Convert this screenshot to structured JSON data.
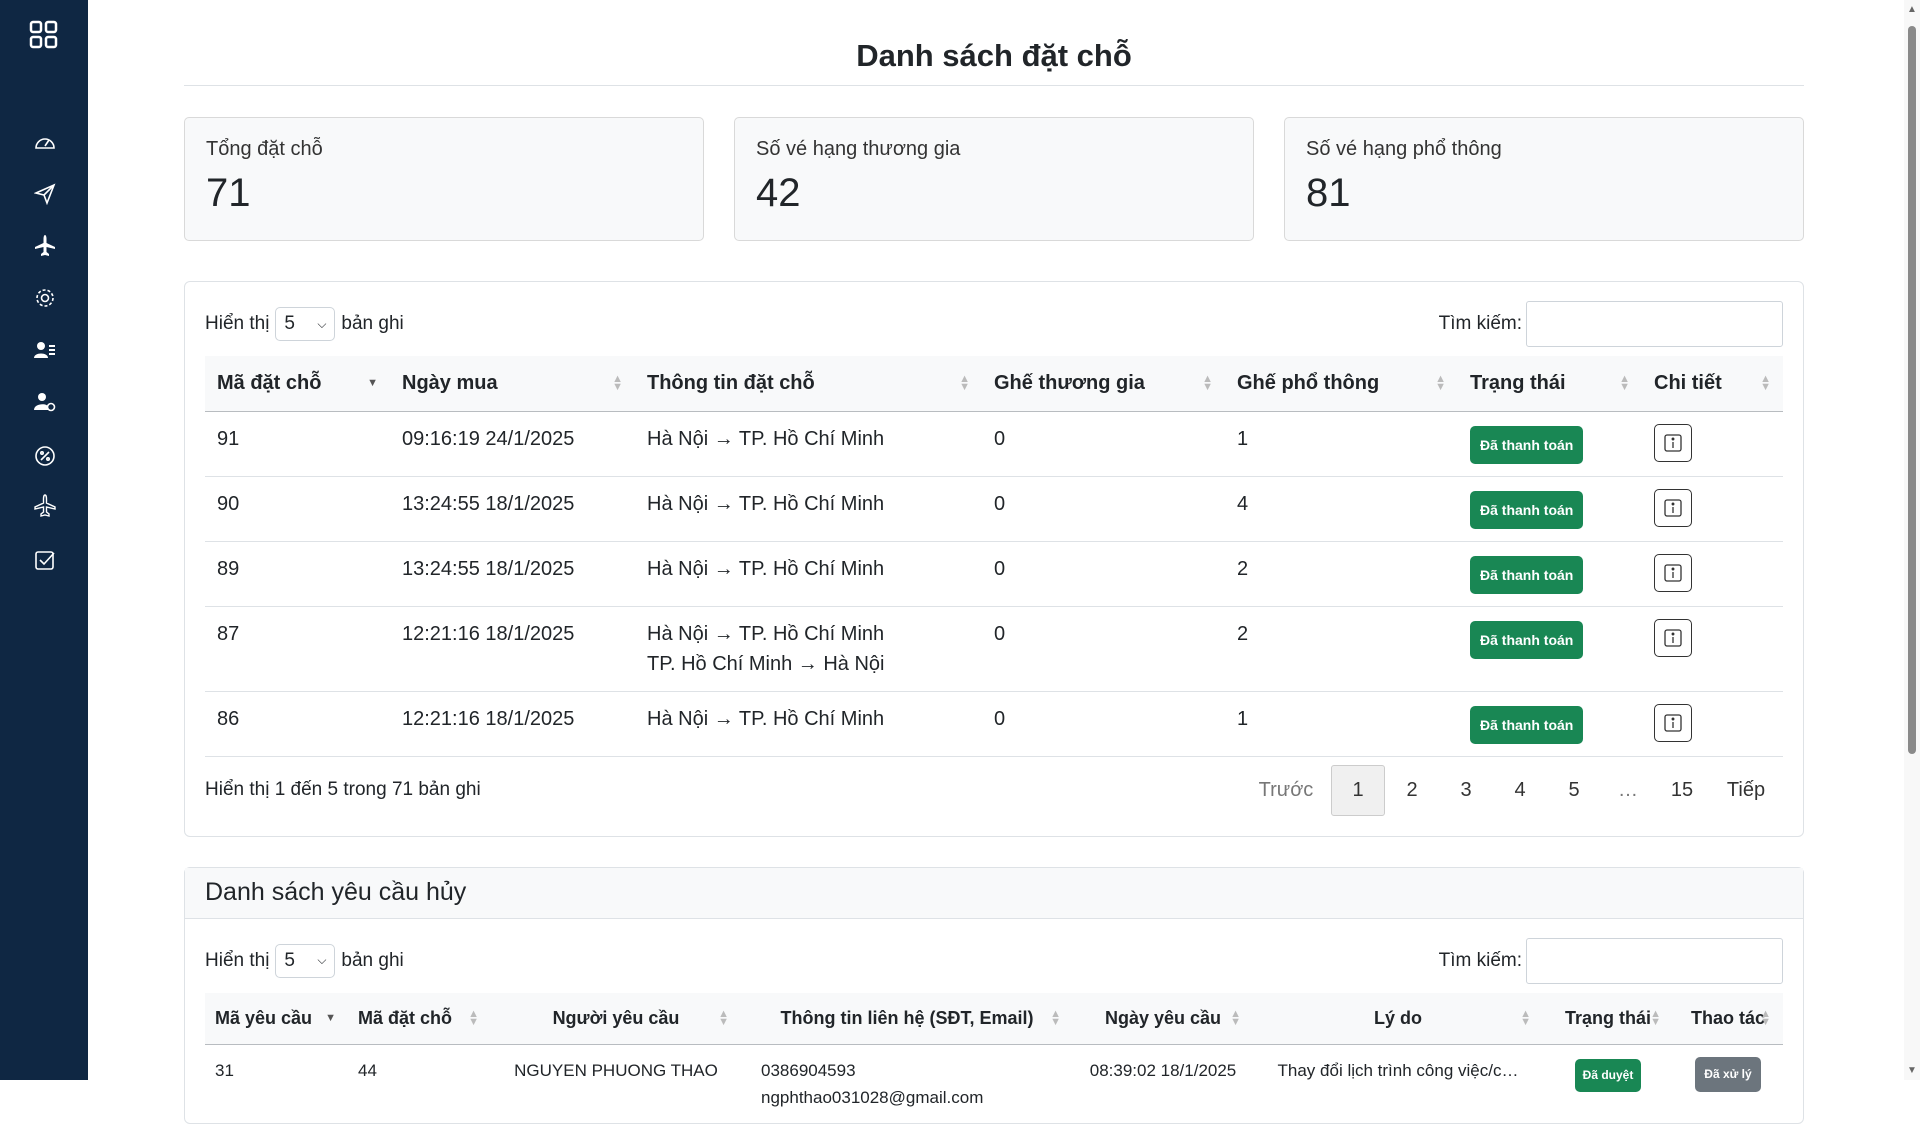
{
  "page": {
    "title": "Danh sách đặt chỗ"
  },
  "sidebar": {
    "logo_icon": "grid-icon",
    "items": [
      {
        "icon": "dashboard-gauge-icon"
      },
      {
        "icon": "paper-plane-icon"
      },
      {
        "icon": "airplane-icon"
      },
      {
        "icon": "gear-icon"
      },
      {
        "icon": "user-list-icon"
      },
      {
        "icon": "user-gear-icon"
      },
      {
        "icon": "discount-badge-icon"
      },
      {
        "icon": "airplane-outline-icon"
      },
      {
        "icon": "checkbox-icon"
      }
    ]
  },
  "stats": [
    {
      "label": "Tổng đặt chỗ",
      "value": "71"
    },
    {
      "label": "Số vé hạng thương gia",
      "value": "42"
    },
    {
      "label": "Số vé hạng phổ thông",
      "value": "81"
    }
  ],
  "bookings": {
    "show_label": "Hiển thị",
    "page_size": "5",
    "records_label": "bản ghi",
    "search_label": "Tìm kiếm:",
    "search_value": "",
    "columns": [
      "Mã đặt chỗ",
      "Ngày mua",
      "Thông tin đặt chỗ",
      "Ghế thương gia",
      "Ghế phổ thông",
      "Trạng thái",
      "Chi tiết"
    ],
    "rows": [
      {
        "id": "91",
        "date": "09:16:19 24/1/2025",
        "route": [
          "Hà Nội → TP. Hồ Chí Minh"
        ],
        "business": "0",
        "economy": "1",
        "status": "Đã thanh toán"
      },
      {
        "id": "90",
        "date": "13:24:55 18/1/2025",
        "route": [
          "Hà Nội → TP. Hồ Chí Minh"
        ],
        "business": "0",
        "economy": "4",
        "status": "Đã thanh toán"
      },
      {
        "id": "89",
        "date": "13:24:55 18/1/2025",
        "route": [
          "Hà Nội → TP. Hồ Chí Minh"
        ],
        "business": "0",
        "economy": "2",
        "status": "Đã thanh toán"
      },
      {
        "id": "87",
        "date": "12:21:16 18/1/2025",
        "route": [
          "Hà Nội → TP. Hồ Chí Minh",
          "TP. Hồ Chí Minh → Hà Nội"
        ],
        "business": "0",
        "economy": "2",
        "status": "Đã thanh toán"
      },
      {
        "id": "86",
        "date": "12:21:16 18/1/2025",
        "route": [
          "Hà Nội → TP. Hồ Chí Minh"
        ],
        "business": "0",
        "economy": "1",
        "status": "Đã thanh toán"
      }
    ],
    "info": "Hiển thị 1 đến 5 trong 71 bản ghi",
    "pagination": {
      "prev": "Trước",
      "pages": [
        "1",
        "2",
        "3",
        "4",
        "5",
        "…",
        "15"
      ],
      "active": "1",
      "next": "Tiếp"
    }
  },
  "cancellations": {
    "title": "Danh sách yêu cầu hủy",
    "show_label": "Hiển thị",
    "page_size": "5",
    "records_label": "bản ghi",
    "search_label": "Tìm kiếm:",
    "search_value": "",
    "columns": [
      "Mã yêu cầu",
      "Mã đặt chỗ",
      "Người yêu cầu",
      "Thông tin liên hệ (SĐT, Email)",
      "Ngày yêu cầu",
      "Lý do",
      "Trạng thái",
      "Thao tác"
    ],
    "rows": [
      {
        "id": "31",
        "booking_id": "44",
        "requester": "NGUYEN PHUONG THAO",
        "phone": "0386904593",
        "email": "ngphthao031028@gmail.com",
        "date": "08:39:02 18/1/2025",
        "reason": "Thay đổi lịch trình công việc/c…",
        "status": "Đã duyệt",
        "action": "Đã xử lý"
      }
    ]
  },
  "colors": {
    "sidebar": "#0f2743",
    "success": "#198754",
    "secondary": "#6c757d"
  }
}
